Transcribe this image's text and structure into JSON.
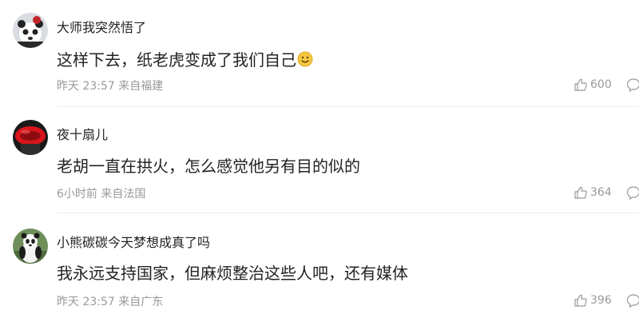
{
  "comments": [
    {
      "username": "大师我突然悟了",
      "content": "这样下去，纸老虎变成了我们自己",
      "emoji": "smile-emoji",
      "time": "昨天 23:57",
      "location": "来自福建",
      "likes": "600"
    },
    {
      "username": "夜十扇儿",
      "content": "老胡一直在拱火，怎么感觉他另有目的似的",
      "time": "6小时前",
      "location": "来自法国",
      "likes": "364"
    },
    {
      "username": "小熊碳碳今天梦想成真了吗",
      "content": "我永远支持国家，但麻烦整治这些人吧，还有媒体",
      "time": "昨天 23:57",
      "location": "来自广东",
      "likes": "396"
    }
  ],
  "icons": {
    "like": "thumbs-up-icon",
    "reply": "comment-bubble-icon"
  },
  "colors": {
    "text": "#222222",
    "meta": "#999999",
    "divider": "#ececec"
  }
}
